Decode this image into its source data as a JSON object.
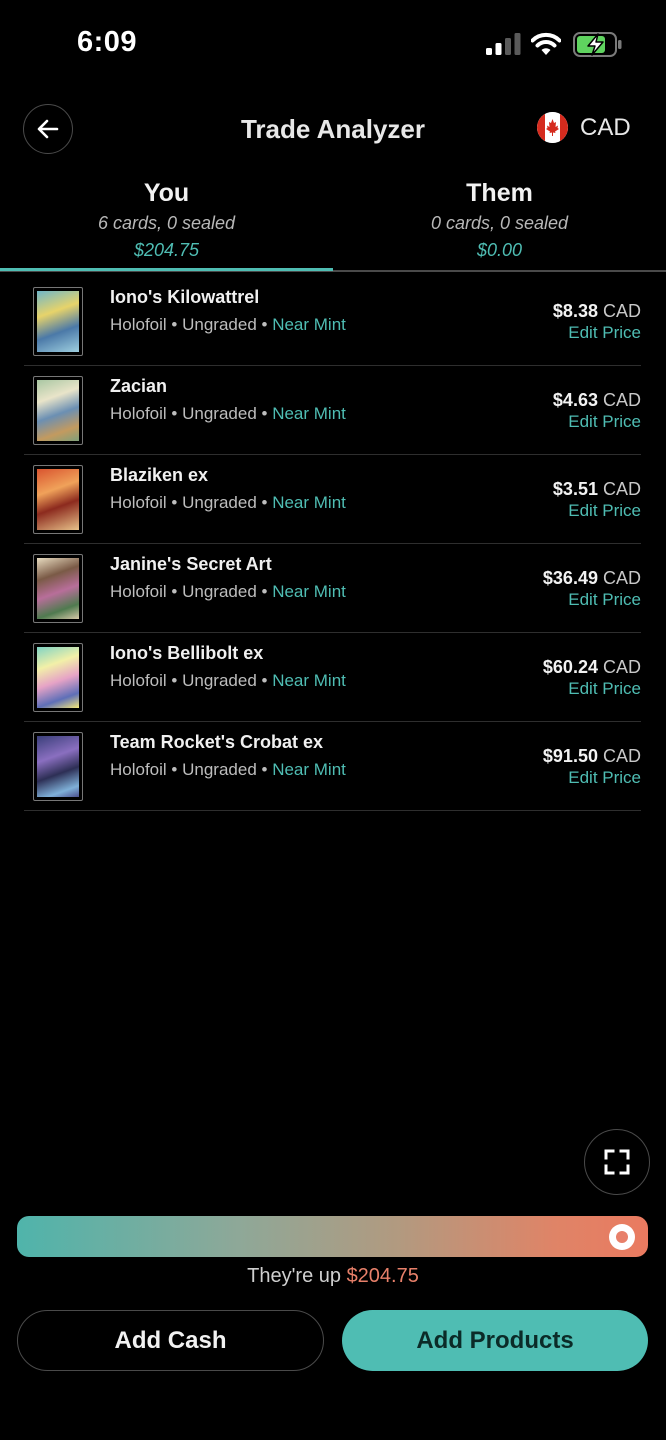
{
  "status_bar": {
    "time": "6:09"
  },
  "header": {
    "title": "Trade Analyzer",
    "currency": "CAD"
  },
  "tabs": [
    {
      "name": "You",
      "summary": "6 cards, 0 sealed",
      "total": "$204.75"
    },
    {
      "name": "Them",
      "summary": "0 cards, 0 sealed",
      "total": "$0.00"
    }
  ],
  "cards": [
    {
      "name": "Iono's Kilowattrel",
      "finish": "Holofoil",
      "grade": "Ungraded",
      "condition": "Near Mint",
      "price": "$8.38",
      "currency": "CAD",
      "edit_label": "Edit Price"
    },
    {
      "name": "Zacian",
      "finish": "Holofoil",
      "grade": "Ungraded",
      "condition": "Near Mint",
      "price": "$4.63",
      "currency": "CAD",
      "edit_label": "Edit Price"
    },
    {
      "name": "Blaziken ex",
      "finish": "Holofoil",
      "grade": "Ungraded",
      "condition": "Near Mint",
      "price": "$3.51",
      "currency": "CAD",
      "edit_label": "Edit Price"
    },
    {
      "name": "Janine's Secret Art",
      "finish": "Holofoil",
      "grade": "Ungraded",
      "condition": "Near Mint",
      "price": "$36.49",
      "currency": "CAD",
      "edit_label": "Edit Price"
    },
    {
      "name": "Iono's Bellibolt ex",
      "finish": "Holofoil",
      "grade": "Ungraded",
      "condition": "Near Mint",
      "price": "$60.24",
      "currency": "CAD",
      "edit_label": "Edit Price"
    },
    {
      "name": "Team Rocket's Crobat ex",
      "finish": "Holofoil",
      "grade": "Ungraded",
      "condition": "Near Mint",
      "price": "$91.50",
      "currency": "CAD",
      "edit_label": "Edit Price"
    }
  ],
  "balance": {
    "prefix": "They're up",
    "amount": "$204.75"
  },
  "actions": {
    "add_cash": "Add Cash",
    "add_products": "Add Products"
  },
  "colors": {
    "accent": "#4fbdb3",
    "negative": "#e8806a",
    "background": "#000000"
  },
  "icons": {
    "back": "arrow-left-icon",
    "flag": "canada-flag-icon",
    "expand": "expand-icon",
    "signal": "cellular-signal-icon",
    "wifi": "wifi-icon",
    "battery": "battery-charging-icon"
  }
}
